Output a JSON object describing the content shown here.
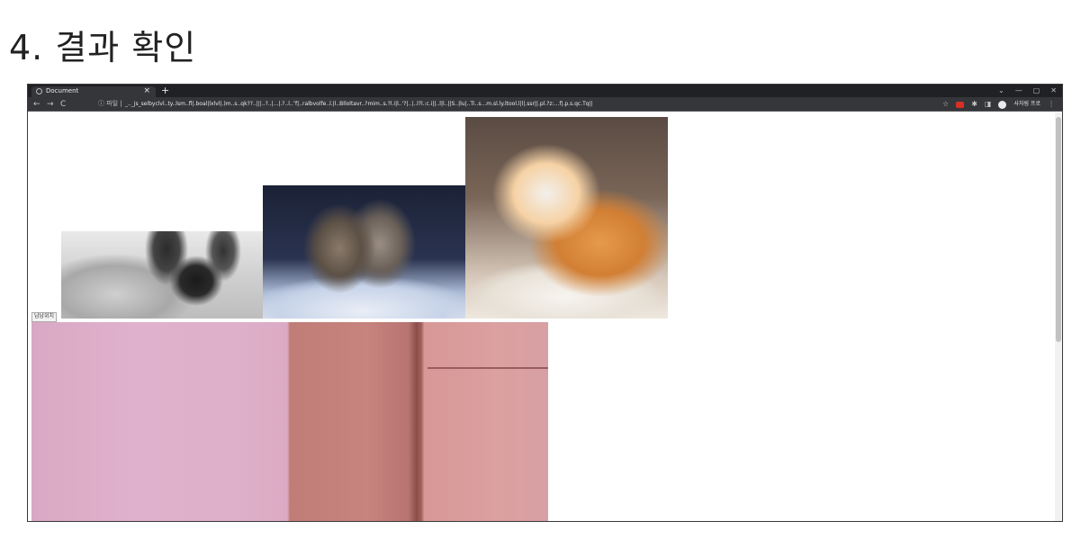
{
  "slide": {
    "title": "4.  결과 확인"
  },
  "browser": {
    "tab_title": "Document",
    "tab_close": "×",
    "new_tab": "+",
    "window_controls": [
      "⌄",
      "—",
      "▢",
      "✕"
    ],
    "nav": {
      "back": "←",
      "forward": "→",
      "reload": "C"
    },
    "address_info": "ⓘ 파일 |",
    "address_url": "_.._js_selbyclvl..ty..lsm..fl|.boal|lxlvl|.)m..s..qk??..|||..?..|...|.?..l..″f|..ralbvolfe..l.|l..Blloltavr..?mim..s.?l.i|l..'?|..|..l?l.:c.i||..l|l..||S..|lu|..Ti..s...m.sl.ly.ltool.l|l|.ssr||.pl.?z:...f|.p.s.qc.Tq||...s.p..c.|l.s..a.″c.t.sl.ly",
    "toolbar_icons": [
      "star-icon",
      "extension-red-icon",
      "puzzle-icon",
      "sidebar-icon",
      "profile-icon",
      "menu-icon"
    ],
    "profile_label": "사자림 프로",
    "star": "☆",
    "puzzle": "✱",
    "sidebar": "◨",
    "menu": "⋮"
  },
  "page": {
    "images": [
      {
        "name": "sphynx-cat-image",
        "description_color": "#c9c9c9"
      },
      {
        "name": "kittens-image",
        "description_color": "#2a3350"
      },
      {
        "name": "ginger-cat-image",
        "description_color": "#e59a4c"
      }
    ],
    "broken_image_alt": "남남위치",
    "video": {
      "accent": "#dca7c3"
    }
  }
}
